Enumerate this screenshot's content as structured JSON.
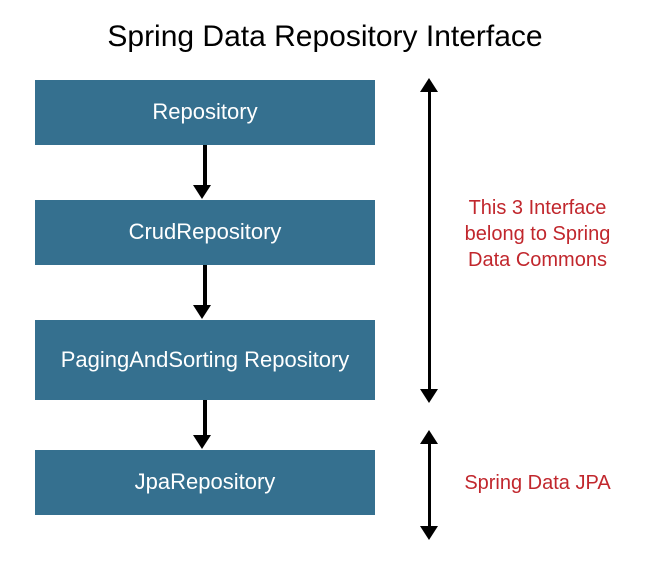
{
  "title": "Spring Data Repository Interface",
  "boxes": [
    {
      "label": "Repository"
    },
    {
      "label": "CrudRepository"
    },
    {
      "label": "PagingAndSorting Repository"
    },
    {
      "label": "JpaRepository"
    }
  ],
  "annotations": {
    "group1": "This 3 Interface belong to Spring Data Commons",
    "group2": "Spring Data JPA"
  }
}
